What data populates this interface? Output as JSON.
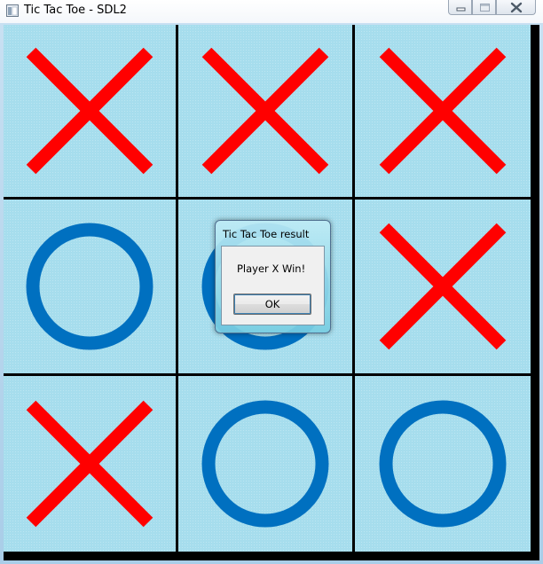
{
  "window": {
    "title": "Tic Tac Toe - SDL2",
    "icon": "app-window-icon",
    "controls": [
      "minimize-icon",
      "maximize-icon",
      "close-icon"
    ]
  },
  "board": {
    "cells": [
      "X",
      "X",
      "X",
      "O",
      "O",
      "X",
      "X",
      "O",
      "O"
    ],
    "x_color": "#ff0000",
    "o_color": "#0070c0",
    "cell_color": "#a6dded",
    "grid_color": "#000000"
  },
  "dialog": {
    "title": "Tic Tac Toe result",
    "message": "Player X Win!",
    "ok_label": "OK"
  }
}
